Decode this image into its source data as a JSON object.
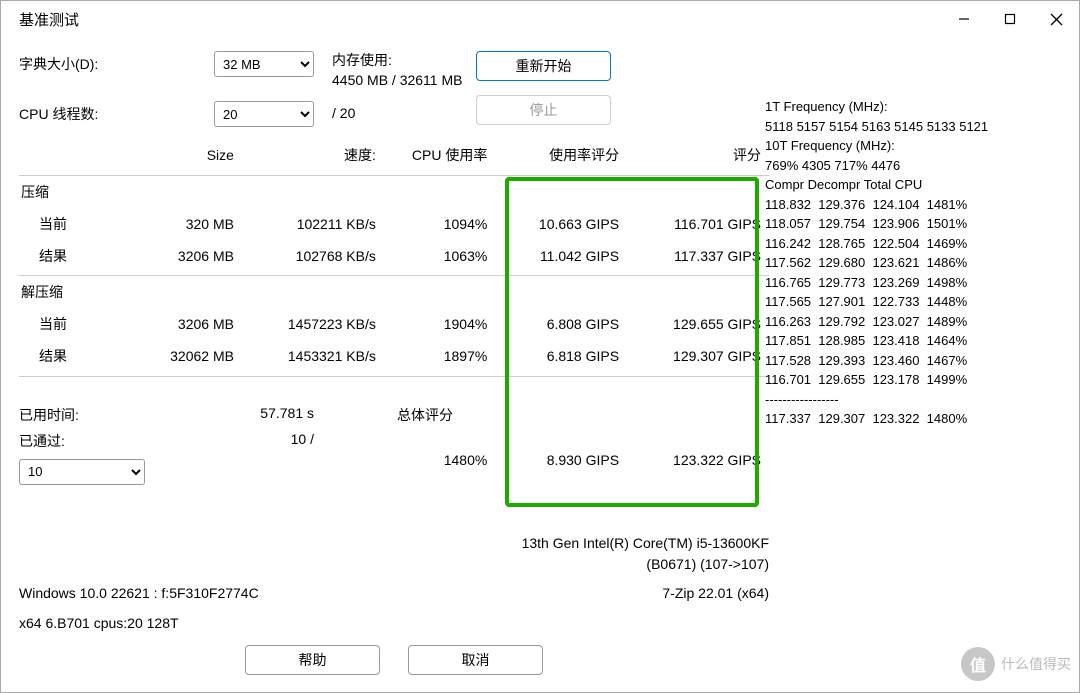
{
  "title": "基准测试",
  "dict_label": "字典大小(D):",
  "dict_value": "32 MB",
  "mem_label": "内存使用:",
  "mem_value": "4450 MB / 32611 MB",
  "threads_label": "CPU 线程数:",
  "threads_value": "20",
  "threads_max": "/ 20",
  "restart": "重新开始",
  "stop": "停止",
  "headers": {
    "size": "Size",
    "speed": "速度:",
    "cpu": "CPU 使用率",
    "rating_u": "使用率评分",
    "rating": "评分"
  },
  "compress_label": "压缩",
  "decompress_label": "解压缩",
  "current_label": "当前",
  "result_label": "结果",
  "rows": {
    "c_cur": {
      "size": "320 MB",
      "speed": "102211 KB/s",
      "cpu": "1094%",
      "urate": "10.663 GIPS",
      "rate": "116.701 GIPS"
    },
    "c_res": {
      "size": "3206 MB",
      "speed": "102768 KB/s",
      "cpu": "1063%",
      "urate": "11.042 GIPS",
      "rate": "117.337 GIPS"
    },
    "d_cur": {
      "size": "3206 MB",
      "speed": "1457223 KB/s",
      "cpu": "1904%",
      "urate": "6.808 GIPS",
      "rate": "129.655 GIPS"
    },
    "d_res": {
      "size": "32062 MB",
      "speed": "1453321 KB/s",
      "cpu": "1897%",
      "urate": "6.818 GIPS",
      "rate": "129.307 GIPS"
    }
  },
  "elapsed_label": "已用时间:",
  "elapsed_value": "57.781 s",
  "passes_label": "已通过:",
  "passes_value": "10 /",
  "passes_select": "10",
  "total_label": "总体评分",
  "total": {
    "cpu": "1480%",
    "urate": "8.930 GIPS",
    "rate": "123.322 GIPS"
  },
  "cpu_line1": "13th Gen Intel(R) Core(TM) i5-13600KF",
  "cpu_line2": "(B0671) (107->107)",
  "os_line": "Windows 10.0 22621 : f:5F310F2774C",
  "zip_line": "7-Zip 22.01 (x64)",
  "arch_line": "x64 6.B701 cpus:20 128T",
  "help": "帮助",
  "cancel": "取消",
  "freq": {
    "t1_label": "1T Frequency (MHz):",
    "t1_values": " 5118 5157 5154 5163 5145 5133 5121",
    "t10_label": "10T Frequency (MHz):",
    "t10_values": " 769% 4305 717% 4476",
    "table_hdr": "Compr Decompr Total   CPU",
    "lines": [
      "118.832  129.376  124.104  1481%",
      "118.057  129.754  123.906  1501%",
      "116.242  128.765  122.504  1469%",
      "117.562  129.680  123.621  1486%",
      "116.765  129.773  123.269  1498%",
      "117.565  127.901  122.733  1448%",
      "116.263  129.792  123.027  1489%",
      "117.851  128.985  123.418  1464%",
      "117.528  129.393  123.460  1467%",
      "116.701  129.655  123.178  1499%"
    ],
    "divider": "-----------------",
    "summary": "117.337  129.307  123.322  1480%"
  },
  "watermark": "什么值得买"
}
